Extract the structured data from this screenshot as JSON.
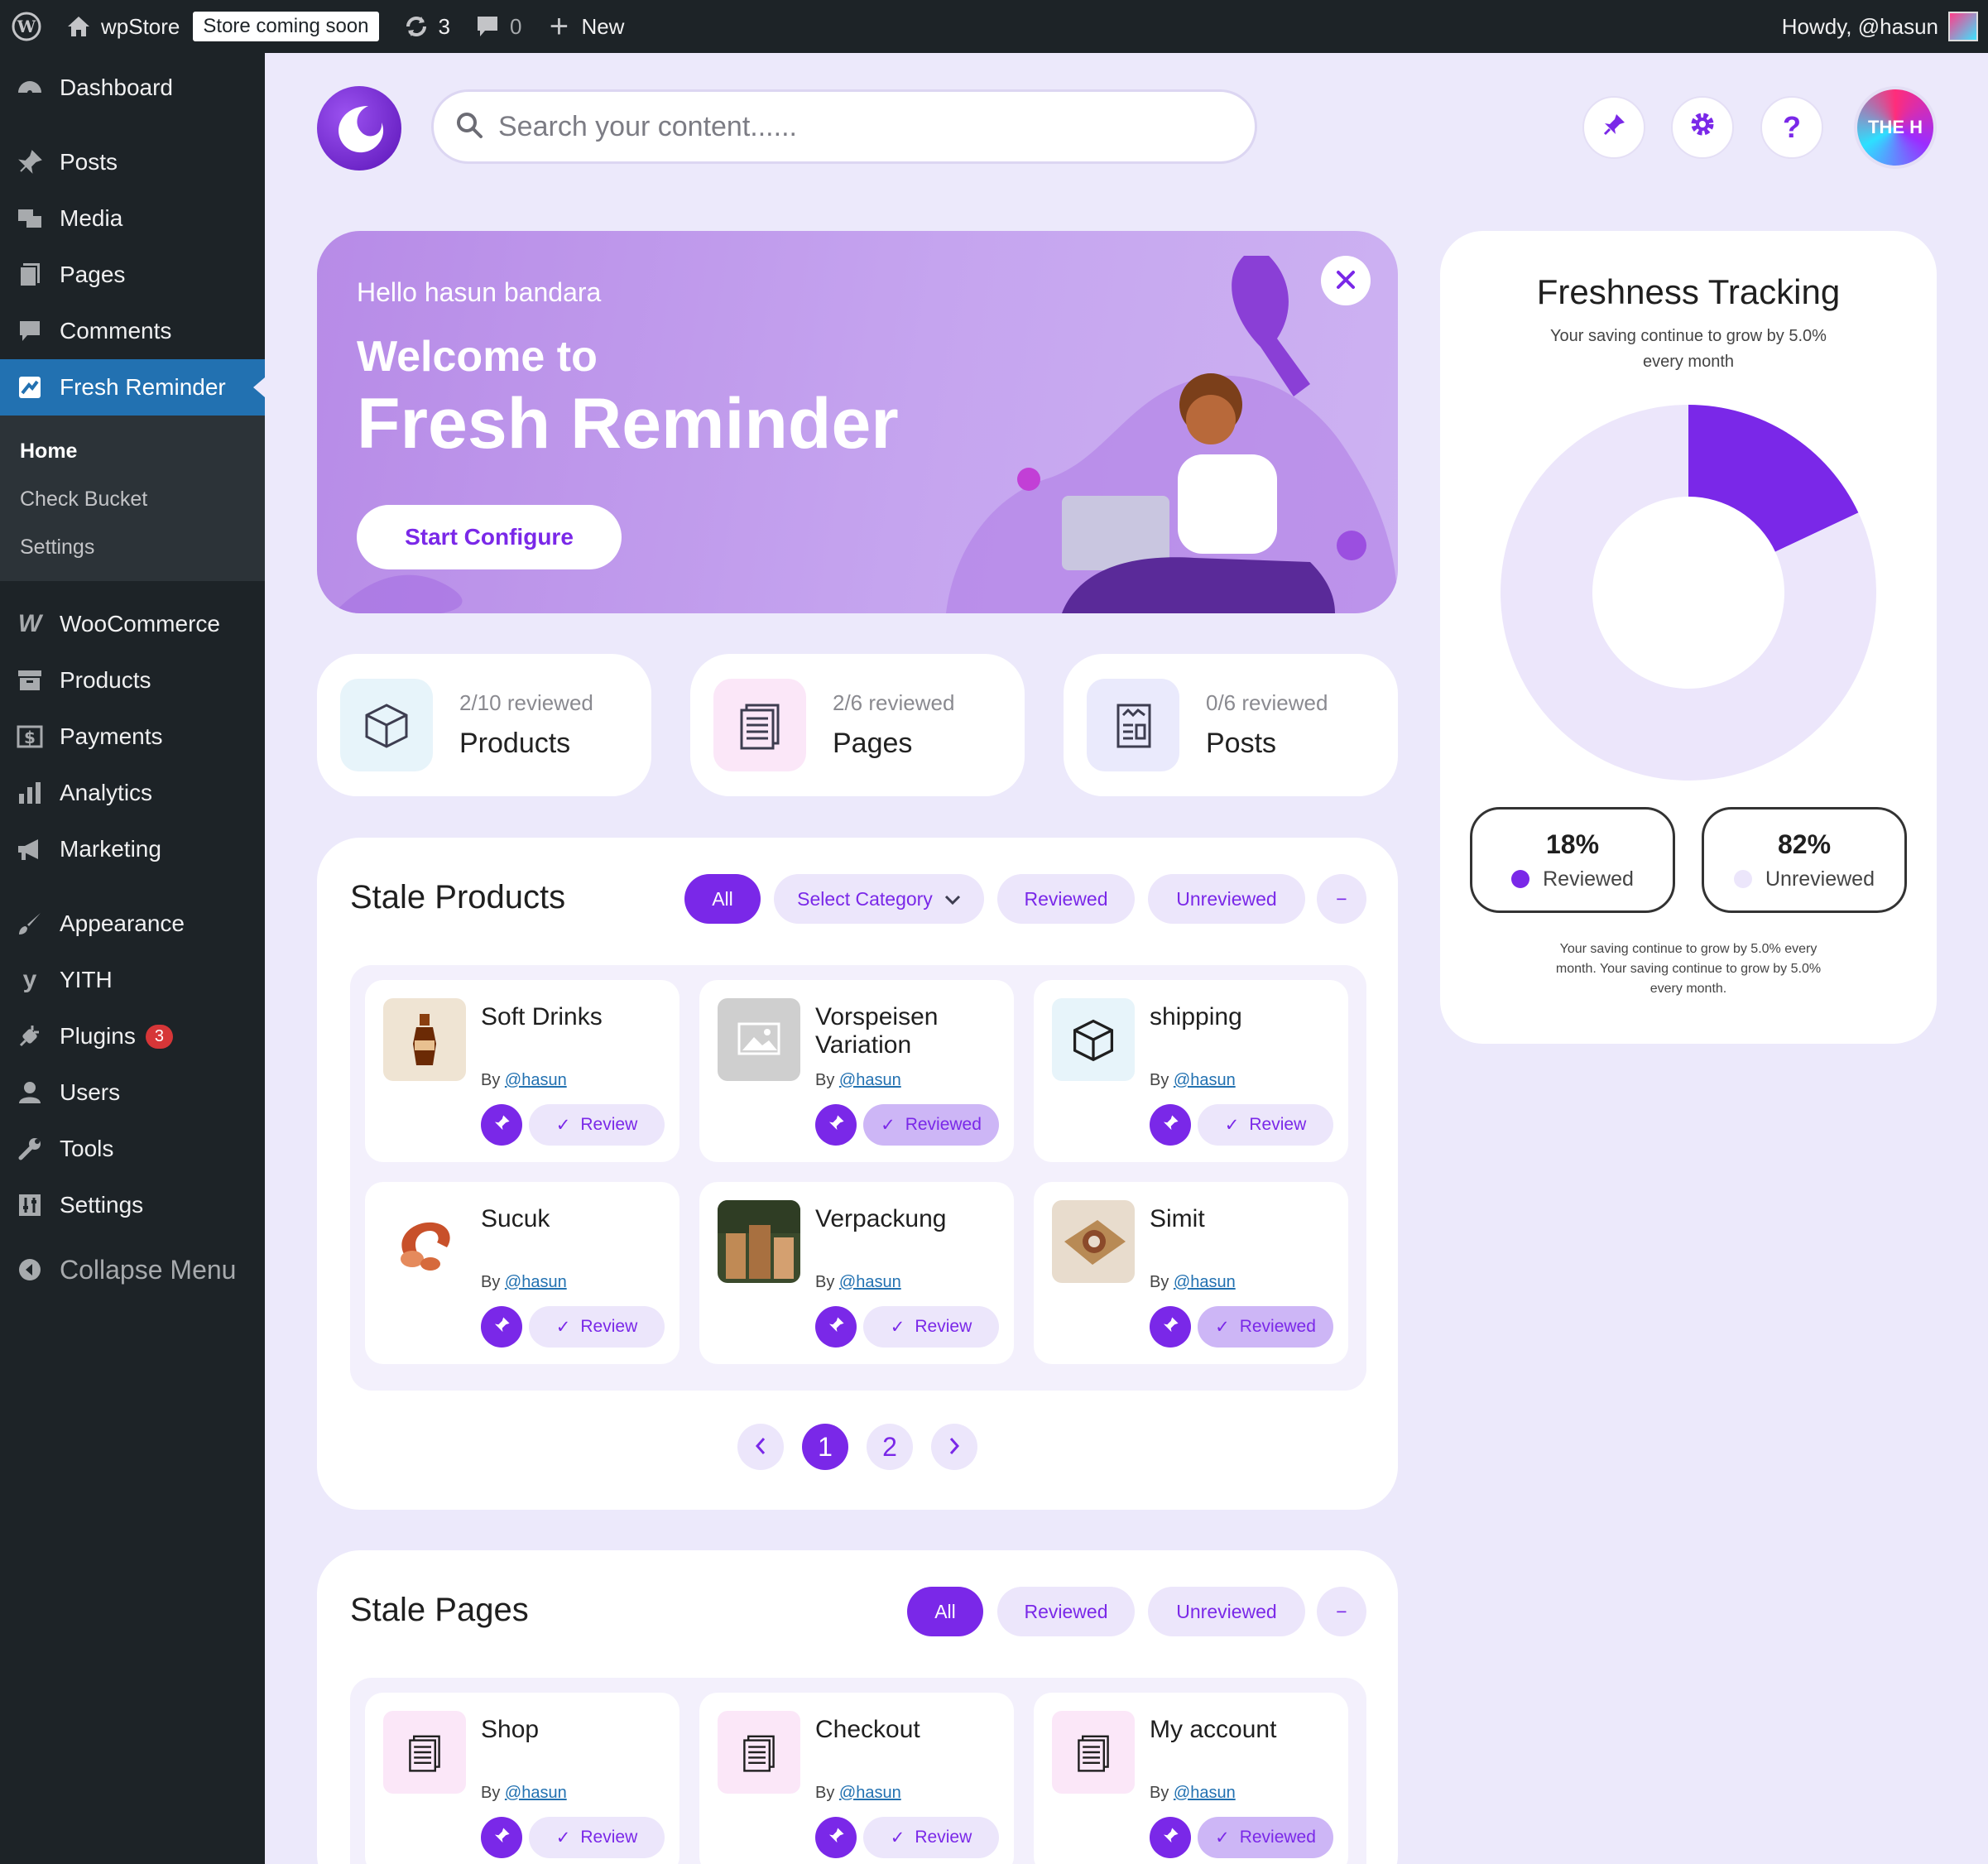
{
  "adminbar": {
    "site": "wpStore",
    "store_badge": "Store coming soon",
    "updates": "3",
    "comments": "0",
    "new": "New",
    "howdy": "Howdy, @hasun"
  },
  "sidebar": {
    "items": [
      {
        "label": "Dashboard",
        "icon": "dashboard-icon"
      },
      {
        "label": "Posts",
        "icon": "pin-icon"
      },
      {
        "label": "Media",
        "icon": "media-icon"
      },
      {
        "label": "Pages",
        "icon": "pages-icon"
      },
      {
        "label": "Comments",
        "icon": "comment-icon"
      },
      {
        "label": "Fresh Reminder",
        "icon": "fresh-reminder-icon"
      }
    ],
    "submenu": [
      "Home",
      "Check Bucket",
      "Settings"
    ],
    "items2": [
      {
        "label": "WooCommerce"
      },
      {
        "label": "Products"
      },
      {
        "label": "Payments"
      },
      {
        "label": "Analytics"
      },
      {
        "label": "Marketing"
      },
      {
        "label": "Appearance"
      },
      {
        "label": "YITH"
      },
      {
        "label": "Plugins",
        "badge": "3"
      },
      {
        "label": "Users"
      },
      {
        "label": "Tools"
      },
      {
        "label": "Settings"
      }
    ],
    "collapse": "Collapse Menu"
  },
  "header": {
    "search_placeholder": "Search your content......",
    "avatar_text": "THE H"
  },
  "banner": {
    "hello": "Hello hasun bandara",
    "welcome": "Welcome to",
    "title": "Fresh Reminder",
    "button": "Start Configure"
  },
  "stats": [
    {
      "reviewed": "2/10 reviewed",
      "title": "Products"
    },
    {
      "reviewed": "2/6 reviewed",
      "title": "Pages"
    },
    {
      "reviewed": "0/6 reviewed",
      "title": "Posts"
    }
  ],
  "stale_products": {
    "title": "Stale Products",
    "filters": {
      "all": "All",
      "category": "Select Category",
      "reviewed": "Reviewed",
      "unreviewed": "Unreviewed"
    },
    "items": [
      {
        "name": "Soft Drinks",
        "by": "By",
        "author": "@hasun",
        "action": "Review"
      },
      {
        "name": "Vorspeisen Variation",
        "by": "By",
        "author": "@hasun",
        "action": "Reviewed"
      },
      {
        "name": "shipping",
        "by": "By",
        "author": "@hasun",
        "action": "Review"
      },
      {
        "name": "Sucuk",
        "by": "By",
        "author": "@hasun",
        "action": "Review"
      },
      {
        "name": "Verpackung",
        "by": "By",
        "author": "@hasun",
        "action": "Review"
      },
      {
        "name": "Simit",
        "by": "By",
        "author": "@hasun",
        "action": "Reviewed"
      }
    ],
    "pages": [
      "1",
      "2"
    ]
  },
  "stale_pages": {
    "title": "Stale Pages",
    "filters": {
      "all": "All",
      "reviewed": "Reviewed",
      "unreviewed": "Unreviewed"
    },
    "items": [
      {
        "name": "Shop",
        "by": "By",
        "author": "@hasun",
        "action": "Review"
      },
      {
        "name": "Checkout",
        "by": "By",
        "author": "@hasun",
        "action": "Review"
      },
      {
        "name": "My account",
        "by": "By",
        "author": "@hasun",
        "action": "Reviewed"
      }
    ]
  },
  "freshness": {
    "title": "Freshness Tracking",
    "subtitle": "Your saving continue to grow by 5.0% every month",
    "reviewed_pct": "18%",
    "reviewed_label": "Reviewed",
    "unreviewed_pct": "82%",
    "unreviewed_label": "Unreviewed",
    "footer": "Your saving continue to grow by 5.0% every month. Your saving continue to grow by 5.0% every month."
  },
  "chart_data": {
    "type": "pie",
    "categories": [
      "Reviewed",
      "Unreviewed"
    ],
    "values": [
      18,
      82
    ],
    "colors": [
      "#7a28e8",
      "#ece6fb"
    ]
  }
}
